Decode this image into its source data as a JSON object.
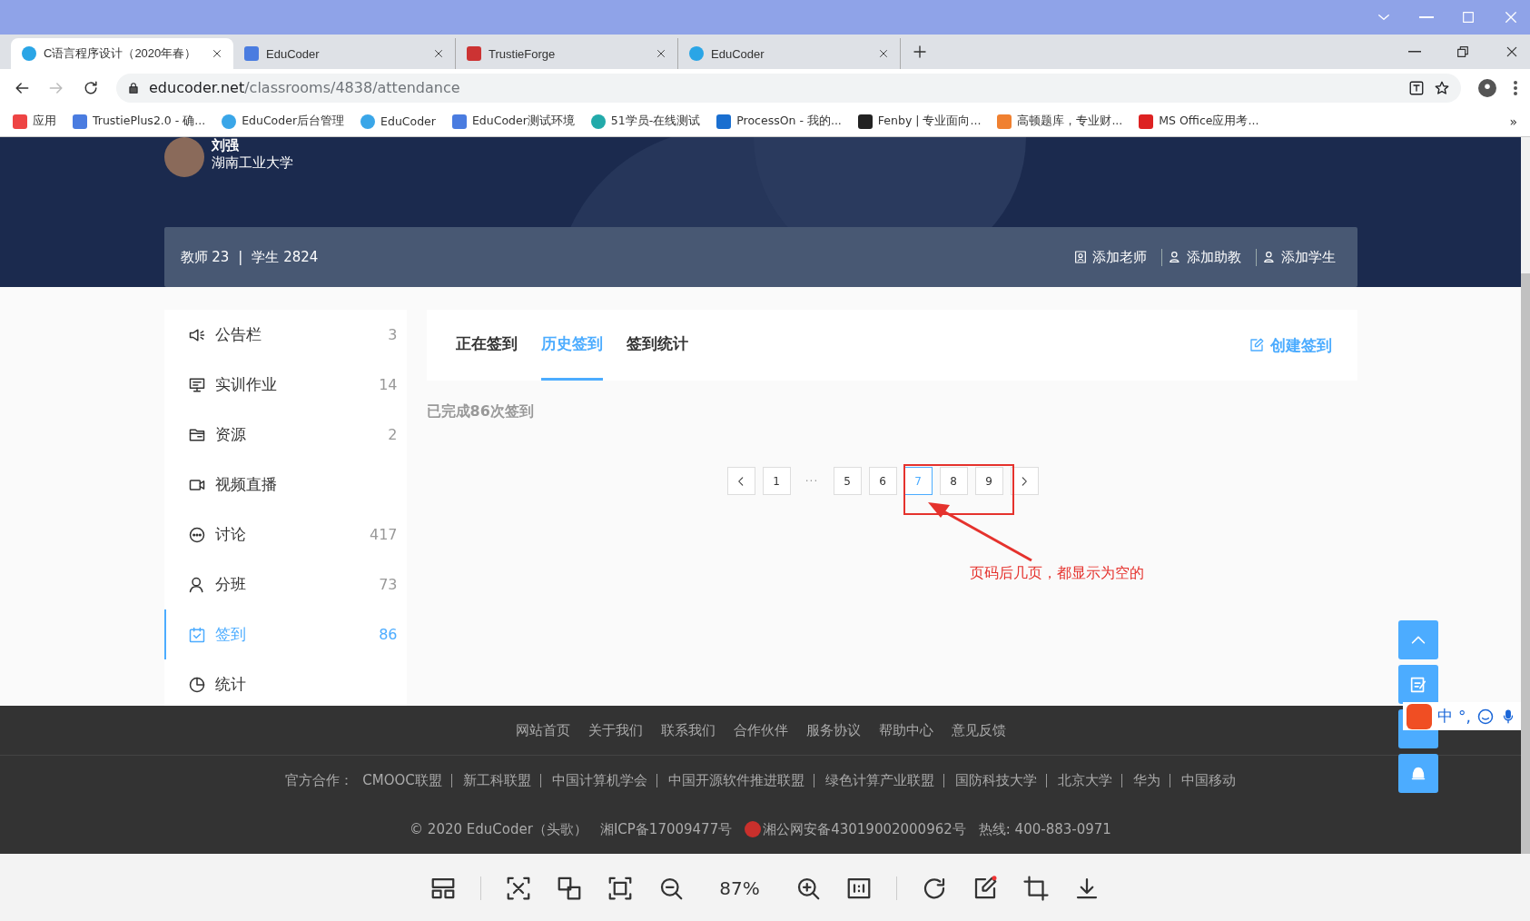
{
  "browser": {
    "tabs": [
      {
        "title": "C语言程序设计（2020年春）",
        "selected": true
      },
      {
        "title": "EduCoder",
        "selected": false
      },
      {
        "title": "TrustieForge",
        "selected": false
      },
      {
        "title": "EduCoder",
        "selected": false
      }
    ],
    "address": {
      "domain": "educoder.net",
      "path": "/classrooms/4838/attendance"
    },
    "bookmarks": [
      "应用",
      "TrustiePlus2.0 - 确...",
      "EduCoder后台管理",
      "EduCoder",
      "EduCoder测试环境",
      "51学员-在线测试",
      "ProcessOn - 我的...",
      "Fenby | 专业面向...",
      "高顿题库，专业财...",
      "MS Office应用考..."
    ],
    "more": "»"
  },
  "header": {
    "user_name": "刘强",
    "school": "湖南工业大学",
    "teachers": "教师 23",
    "separator": "|",
    "students": "学生 2824",
    "actions": [
      "添加老师",
      "添加助教",
      "添加学生"
    ]
  },
  "sidebar": {
    "items": [
      {
        "label": "公告栏",
        "count": "3",
        "selected": false
      },
      {
        "label": "实训作业",
        "count": "14",
        "selected": false
      },
      {
        "label": "资源",
        "count": "2",
        "selected": false
      },
      {
        "label": "视频直播",
        "selected": false
      },
      {
        "label": "讨论",
        "count": "417",
        "selected": false
      },
      {
        "label": "分班",
        "count": "73",
        "selected": false
      },
      {
        "label": "签到",
        "count": "86",
        "selected": true
      },
      {
        "label": "统计",
        "selected": false
      }
    ]
  },
  "main": {
    "tabs": [
      {
        "label": "正在签到",
        "selected": false
      },
      {
        "label": "历史签到",
        "selected": true
      },
      {
        "label": "签到统计",
        "selected": false
      }
    ],
    "create_button": "创建签到",
    "summary": "已完成86次签到",
    "pagination": [
      {
        "kind": "prev",
        "selected": false
      },
      {
        "kind": "page",
        "label": "1",
        "selected": false
      },
      {
        "kind": "ellipsis",
        "label": "···"
      },
      {
        "kind": "page",
        "label": "5",
        "selected": false
      },
      {
        "kind": "page",
        "label": "6",
        "selected": false
      },
      {
        "kind": "page",
        "label": "7",
        "selected": true
      },
      {
        "kind": "page",
        "label": "8",
        "selected": false
      },
      {
        "kind": "page",
        "label": "9",
        "selected": false
      },
      {
        "kind": "next",
        "selected": false
      }
    ],
    "annotation": "页码后几页，都显示为空的"
  },
  "footer": {
    "links": [
      "网站首页",
      "关于我们",
      "联系我们",
      "合作伙伴",
      "服务协议",
      "帮助中心",
      "意见反馈"
    ],
    "partners_label": "官方合作：",
    "partners": [
      "CMOOC联盟",
      "新工科联盟",
      "中国计算机学会",
      "中国开源软件推进联盟",
      "绿色计算产业联盟",
      "国防科技大学",
      "北京大学",
      "华为",
      "中国移动"
    ],
    "copyright": "© 2020 EduCoder（头歌）",
    "icp": "湘ICP备17009477号",
    "police": "湘公网安备43019002000962号",
    "hotline": "热线: 400-883-0971"
  },
  "ime": [
    "中",
    "°,"
  ],
  "viewer": {
    "zoom": "87%"
  }
}
